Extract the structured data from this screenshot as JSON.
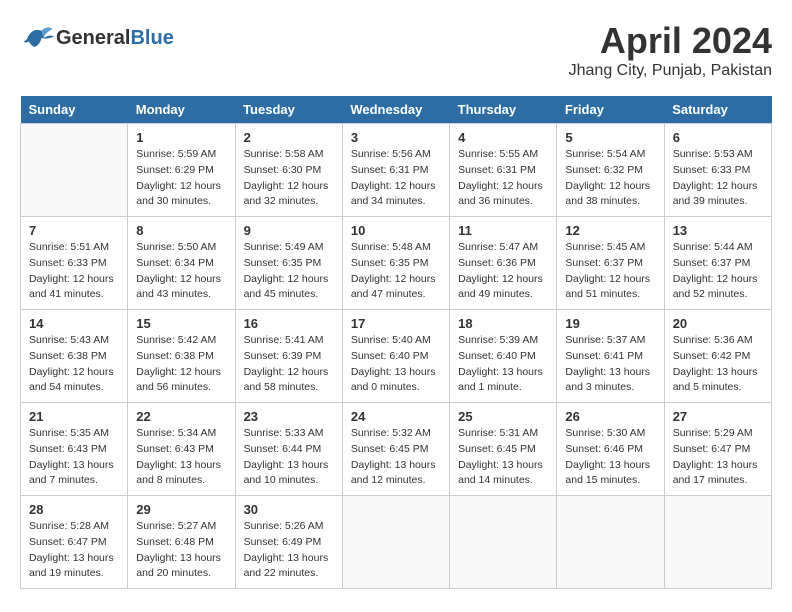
{
  "header": {
    "logo_general": "General",
    "logo_blue": "Blue",
    "month_title": "April 2024",
    "city": "Jhang City, Punjab, Pakistan"
  },
  "calendar": {
    "days_of_week": [
      "Sunday",
      "Monday",
      "Tuesday",
      "Wednesday",
      "Thursday",
      "Friday",
      "Saturday"
    ],
    "weeks": [
      [
        {
          "day": "",
          "info": ""
        },
        {
          "day": "1",
          "info": "Sunrise: 5:59 AM\nSunset: 6:29 PM\nDaylight: 12 hours\nand 30 minutes."
        },
        {
          "day": "2",
          "info": "Sunrise: 5:58 AM\nSunset: 6:30 PM\nDaylight: 12 hours\nand 32 minutes."
        },
        {
          "day": "3",
          "info": "Sunrise: 5:56 AM\nSunset: 6:31 PM\nDaylight: 12 hours\nand 34 minutes."
        },
        {
          "day": "4",
          "info": "Sunrise: 5:55 AM\nSunset: 6:31 PM\nDaylight: 12 hours\nand 36 minutes."
        },
        {
          "day": "5",
          "info": "Sunrise: 5:54 AM\nSunset: 6:32 PM\nDaylight: 12 hours\nand 38 minutes."
        },
        {
          "day": "6",
          "info": "Sunrise: 5:53 AM\nSunset: 6:33 PM\nDaylight: 12 hours\nand 39 minutes."
        }
      ],
      [
        {
          "day": "7",
          "info": "Sunrise: 5:51 AM\nSunset: 6:33 PM\nDaylight: 12 hours\nand 41 minutes."
        },
        {
          "day": "8",
          "info": "Sunrise: 5:50 AM\nSunset: 6:34 PM\nDaylight: 12 hours\nand 43 minutes."
        },
        {
          "day": "9",
          "info": "Sunrise: 5:49 AM\nSunset: 6:35 PM\nDaylight: 12 hours\nand 45 minutes."
        },
        {
          "day": "10",
          "info": "Sunrise: 5:48 AM\nSunset: 6:35 PM\nDaylight: 12 hours\nand 47 minutes."
        },
        {
          "day": "11",
          "info": "Sunrise: 5:47 AM\nSunset: 6:36 PM\nDaylight: 12 hours\nand 49 minutes."
        },
        {
          "day": "12",
          "info": "Sunrise: 5:45 AM\nSunset: 6:37 PM\nDaylight: 12 hours\nand 51 minutes."
        },
        {
          "day": "13",
          "info": "Sunrise: 5:44 AM\nSunset: 6:37 PM\nDaylight: 12 hours\nand 52 minutes."
        }
      ],
      [
        {
          "day": "14",
          "info": "Sunrise: 5:43 AM\nSunset: 6:38 PM\nDaylight: 12 hours\nand 54 minutes."
        },
        {
          "day": "15",
          "info": "Sunrise: 5:42 AM\nSunset: 6:38 PM\nDaylight: 12 hours\nand 56 minutes."
        },
        {
          "day": "16",
          "info": "Sunrise: 5:41 AM\nSunset: 6:39 PM\nDaylight: 12 hours\nand 58 minutes."
        },
        {
          "day": "17",
          "info": "Sunrise: 5:40 AM\nSunset: 6:40 PM\nDaylight: 13 hours\nand 0 minutes."
        },
        {
          "day": "18",
          "info": "Sunrise: 5:39 AM\nSunset: 6:40 PM\nDaylight: 13 hours\nand 1 minute."
        },
        {
          "day": "19",
          "info": "Sunrise: 5:37 AM\nSunset: 6:41 PM\nDaylight: 13 hours\nand 3 minutes."
        },
        {
          "day": "20",
          "info": "Sunrise: 5:36 AM\nSunset: 6:42 PM\nDaylight: 13 hours\nand 5 minutes."
        }
      ],
      [
        {
          "day": "21",
          "info": "Sunrise: 5:35 AM\nSunset: 6:43 PM\nDaylight: 13 hours\nand 7 minutes."
        },
        {
          "day": "22",
          "info": "Sunrise: 5:34 AM\nSunset: 6:43 PM\nDaylight: 13 hours\nand 8 minutes."
        },
        {
          "day": "23",
          "info": "Sunrise: 5:33 AM\nSunset: 6:44 PM\nDaylight: 13 hours\nand 10 minutes."
        },
        {
          "day": "24",
          "info": "Sunrise: 5:32 AM\nSunset: 6:45 PM\nDaylight: 13 hours\nand 12 minutes."
        },
        {
          "day": "25",
          "info": "Sunrise: 5:31 AM\nSunset: 6:45 PM\nDaylight: 13 hours\nand 14 minutes."
        },
        {
          "day": "26",
          "info": "Sunrise: 5:30 AM\nSunset: 6:46 PM\nDaylight: 13 hours\nand 15 minutes."
        },
        {
          "day": "27",
          "info": "Sunrise: 5:29 AM\nSunset: 6:47 PM\nDaylight: 13 hours\nand 17 minutes."
        }
      ],
      [
        {
          "day": "28",
          "info": "Sunrise: 5:28 AM\nSunset: 6:47 PM\nDaylight: 13 hours\nand 19 minutes."
        },
        {
          "day": "29",
          "info": "Sunrise: 5:27 AM\nSunset: 6:48 PM\nDaylight: 13 hours\nand 20 minutes."
        },
        {
          "day": "30",
          "info": "Sunrise: 5:26 AM\nSunset: 6:49 PM\nDaylight: 13 hours\nand 22 minutes."
        },
        {
          "day": "",
          "info": ""
        },
        {
          "day": "",
          "info": ""
        },
        {
          "day": "",
          "info": ""
        },
        {
          "day": "",
          "info": ""
        }
      ]
    ]
  }
}
